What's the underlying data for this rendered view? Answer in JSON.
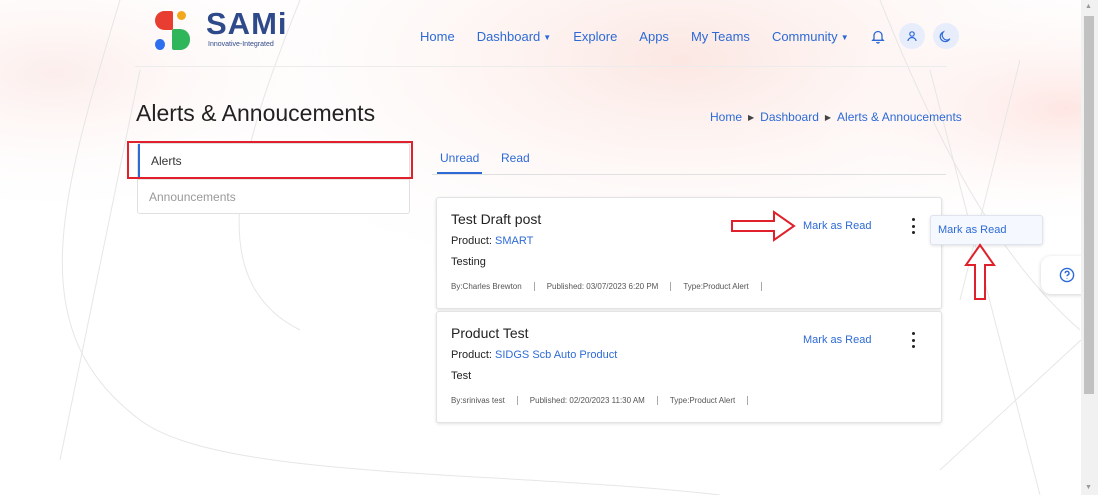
{
  "brand": {
    "name": "SAMi",
    "tagline": "Innovative-Integrated"
  },
  "nav": {
    "items": [
      {
        "label": "Home"
      },
      {
        "label": "Dashboard",
        "dropdown": true
      },
      {
        "label": "Explore"
      },
      {
        "label": "Apps"
      },
      {
        "label": "My Teams"
      },
      {
        "label": "Community",
        "dropdown": true
      }
    ],
    "icons": [
      "bell-icon",
      "user-icon",
      "moon-icon"
    ]
  },
  "page": {
    "title": "Alerts & Annoucements"
  },
  "breadcrumb": [
    "Home",
    "Dashboard",
    "Alerts & Annoucements"
  ],
  "sidebar": {
    "items": [
      {
        "label": "Alerts"
      },
      {
        "label": "Announcements"
      }
    ]
  },
  "tabs": [
    {
      "label": "Unread"
    },
    {
      "label": "Read"
    }
  ],
  "alerts": [
    {
      "title": "Test Draft post",
      "product_label": "Product:",
      "product": "SMART",
      "description": "Testing",
      "by": "By:Charles Brewton",
      "published": "Published: 03/07/2023 6:20 PM",
      "type": "Type:Product Alert",
      "action": "Mark as Read"
    },
    {
      "title": "Product Test",
      "product_label": "Product:",
      "product": "SIDGS Scb Auto Product",
      "description": "Test",
      "by": "By:srinivas test",
      "published": "Published: 02/20/2023 11:30 AM",
      "type": "Type:Product Alert",
      "action": "Mark as Read"
    }
  ],
  "popup": {
    "label": "Mark as Read"
  },
  "colors": {
    "accent": "#2d6ad6",
    "annotation": "#e0202a"
  }
}
